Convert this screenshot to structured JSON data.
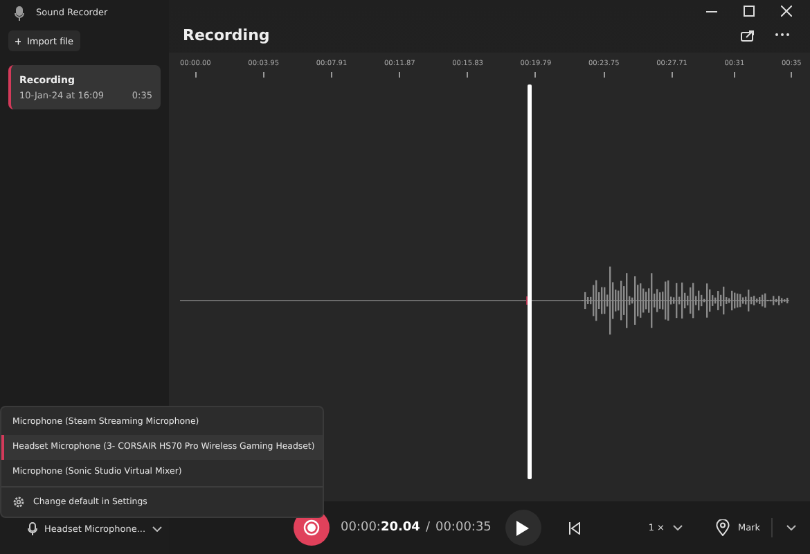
{
  "window": {
    "title": "Sound Recorder"
  },
  "sidebar": {
    "import_button": "Import file",
    "recordings": [
      {
        "name": "Recording",
        "date": "10-Jan-24 at 16:09",
        "duration": "0:35",
        "selected": true
      }
    ]
  },
  "main": {
    "title": "Recording",
    "timeline": [
      "00:00.00",
      "00:03.95",
      "00:07.91",
      "00:11.87",
      "00:15.83",
      "00:19.79",
      "00:23.75",
      "00:27.71",
      "00:31",
      "00:35"
    ],
    "playhead": {
      "level": 0.555
    }
  },
  "mic_menu": {
    "items": [
      {
        "label": "Microphone (Steam Streaming Microphone)",
        "selected": false
      },
      {
        "label": "Headset Microphone (3- CORSAIR HS70 Pro Wireless Gaming Headset)",
        "selected": true
      },
      {
        "label": "Microphone (Sonic Studio Virtual Mixer)",
        "selected": false
      }
    ],
    "settings": "Change default in Settings"
  },
  "bottom_bar": {
    "mic": "Headset Microphone...",
    "time": "00:00:**20.04**",
    "separator": "/",
    "total": "00:00:35",
    "speed": "1 ×",
    "mark": "Mark"
  }
}
